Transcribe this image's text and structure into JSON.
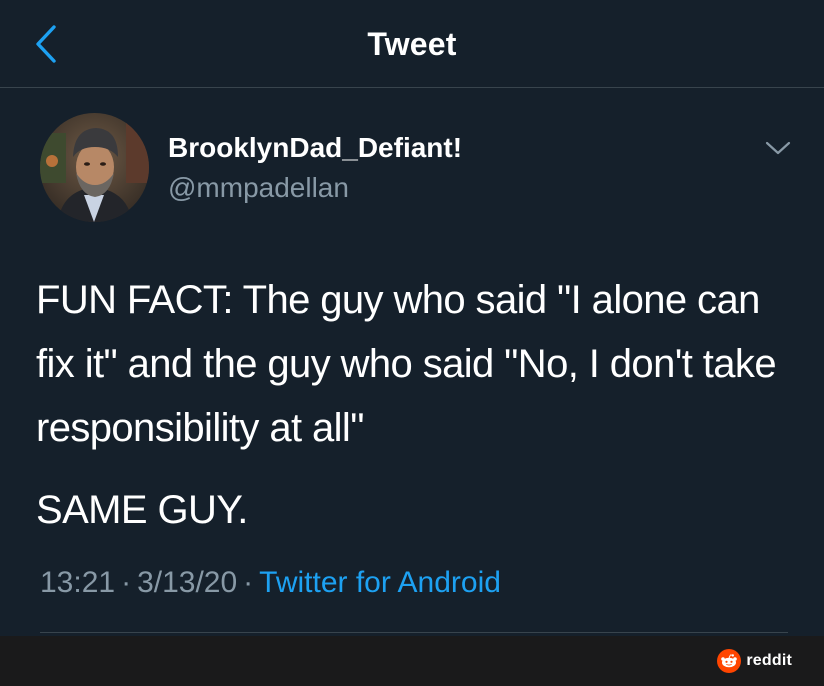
{
  "header": {
    "title": "Tweet",
    "back_icon": "chevron-left-icon"
  },
  "tweet": {
    "author_name": "BrooklynDad_Defiant!",
    "author_handle": "@mmpadellan",
    "text_paragraph_1": "FUN FACT: The guy who said \"I alone can fix it\" and the guy who said \"No, I don't take responsibility at all\"",
    "text_paragraph_2": "SAME GUY.",
    "time": "13:21",
    "date": "3/13/20",
    "source": "Twitter for Android",
    "separator": "·",
    "more_icon": "chevron-down-icon"
  },
  "watermark": {
    "label": "reddit"
  },
  "colors": {
    "background": "#15202b",
    "accent": "#1da1f2",
    "secondary_text": "#8899a6",
    "divider": "#38444d",
    "reddit_orange": "#ff4500"
  }
}
